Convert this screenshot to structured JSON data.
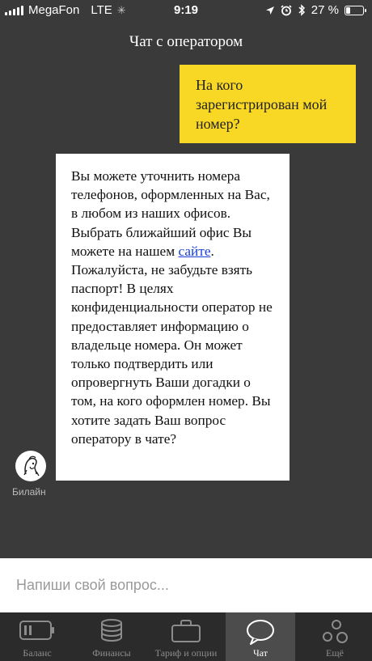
{
  "status_bar": {
    "carrier": "MegaFon",
    "network": "LTE",
    "time": "9:19",
    "battery_percent": "27 %",
    "battery_level": 0.27
  },
  "header": {
    "title": "Чат с оператором"
  },
  "messages": {
    "user": "На кого зарегистрирован мой номер?",
    "operator_part1": "Вы можете уточнить номера телефонов, оформленных на Вас, в любом из наших офисов. Выбрать ближайший офис Вы можете на нашем ",
    "operator_link": "сайте",
    "operator_part2": ". Пожалуйста, не забудьте взять паспорт! В целях конфиденциальности оператор не предоставляет информацию о владельце номера. Он может только подтвердить или опровергнуть Ваши догадки о том, на кого оформлен номер. Вы хотите задать Ваш вопрос оператору в чате?",
    "operator_name": "Билайн"
  },
  "input": {
    "placeholder": "Напиши свой вопрос..."
  },
  "tabs": [
    {
      "label": "Баланс",
      "icon": "battery-icon"
    },
    {
      "label": "Финансы",
      "icon": "coins-icon"
    },
    {
      "label": "Тариф и опции",
      "icon": "briefcase-icon"
    },
    {
      "label": "Чат",
      "icon": "chat-bubble-icon"
    },
    {
      "label": "Ещё",
      "icon": "more-circles-icon"
    }
  ],
  "colors": {
    "accent": "#f8d824",
    "background": "#3a3a3a",
    "tabbar": "#2b2b2b",
    "link": "#1a3fd8"
  }
}
